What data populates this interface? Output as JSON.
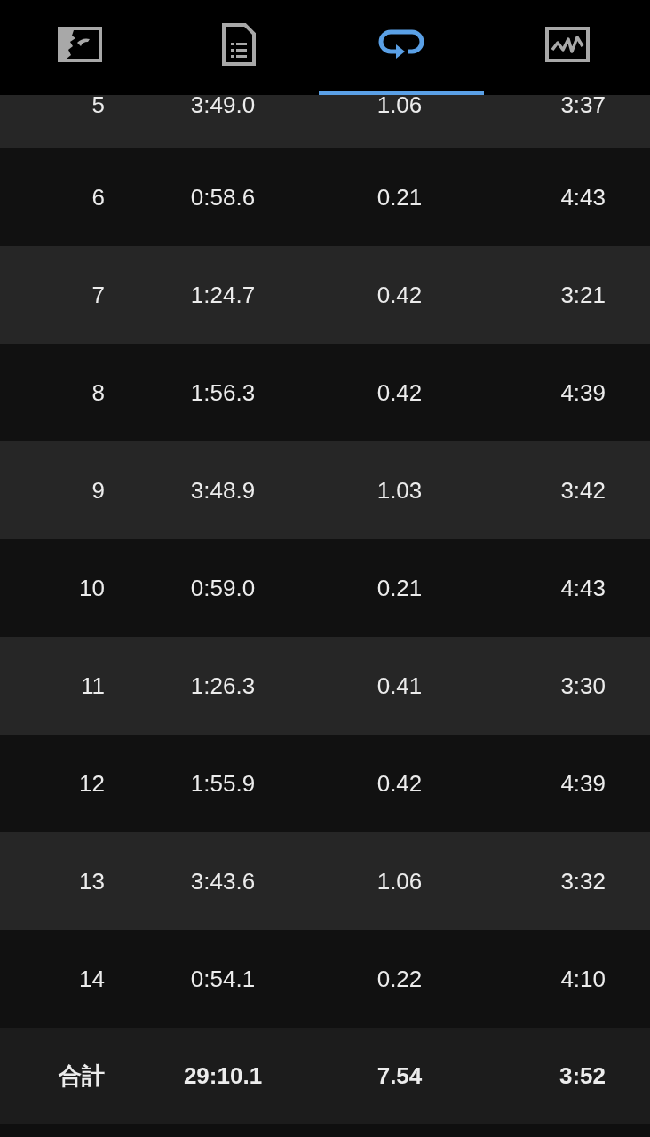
{
  "tabs": [
    {
      "kind": "map",
      "selected": false
    },
    {
      "kind": "document",
      "selected": false
    },
    {
      "kind": "laps",
      "selected": true
    },
    {
      "kind": "chart",
      "selected": false
    }
  ],
  "laps": [
    [
      "5",
      "3:49.0",
      "1.06",
      "3:37"
    ],
    [
      "6",
      "0:58.6",
      "0.21",
      "4:43"
    ],
    [
      "7",
      "1:24.7",
      "0.42",
      "3:21"
    ],
    [
      "8",
      "1:56.3",
      "0.42",
      "4:39"
    ],
    [
      "9",
      "3:48.9",
      "1.03",
      "3:42"
    ],
    [
      "10",
      "0:59.0",
      "0.21",
      "4:43"
    ],
    [
      "11",
      "1:26.3",
      "0.41",
      "3:30"
    ],
    [
      "12",
      "1:55.9",
      "0.42",
      "4:39"
    ],
    [
      "13",
      "3:43.6",
      "1.06",
      "3:32"
    ],
    [
      "14",
      "0:54.1",
      "0.22",
      "4:10"
    ]
  ],
  "total": [
    "合計",
    "29:10.1",
    "7.54",
    "3:52"
  ]
}
